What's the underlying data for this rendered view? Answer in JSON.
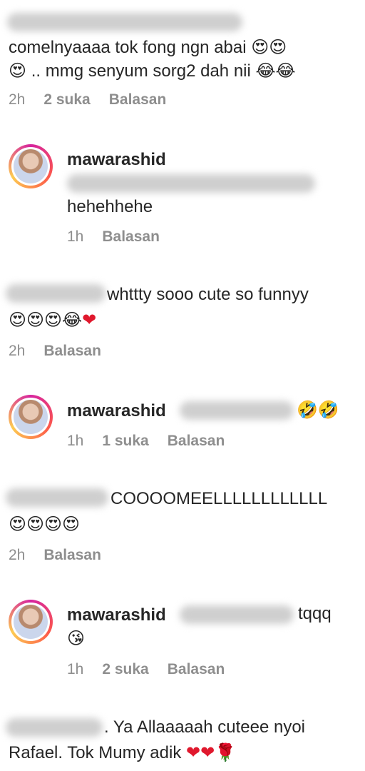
{
  "comments": [
    {
      "text_line1": "comelnyaaaa tok fong ngn abai",
      "line1_emoji": "😍😍",
      "line2_emoji": "😍",
      "text_line2": ".. mmg senyum sorg2 dah nii",
      "line2_end_emoji": "😂😂",
      "time": "2h",
      "likes": "2 suka",
      "reply": "Balasan"
    },
    {
      "username": "mawarashid",
      "text": "hehehhehe",
      "time": "1h",
      "reply": "Balasan"
    },
    {
      "text_line1": "whttty sooo cute so funnyy",
      "emoji": "😍😍😍😂",
      "heart": "❤",
      "time": "2h",
      "reply": "Balasan"
    },
    {
      "username": "mawarashid",
      "emoji": "🤣🤣",
      "time": "1h",
      "likes": "1 suka",
      "reply": "Balasan"
    },
    {
      "text_line1": "COOOOMEELLLLLLLLLLLL",
      "emoji": "😍😍😍😍",
      "time": "2h",
      "reply": "Balasan"
    },
    {
      "username": "mawarashid",
      "text": "tqqq",
      "emoji": "😘",
      "time": "1h",
      "likes": "2 suka",
      "reply": "Balasan"
    },
    {
      "text_line1": ". Ya Allaaaaah cuteee nyoi",
      "text_line2": "Rafael. Tok Mumy adik",
      "hearts": "❤❤",
      "rose": "🌹"
    }
  ],
  "colors": {
    "text": "#262626",
    "meta": "#8e8e8e",
    "heart": "#e0182d"
  }
}
